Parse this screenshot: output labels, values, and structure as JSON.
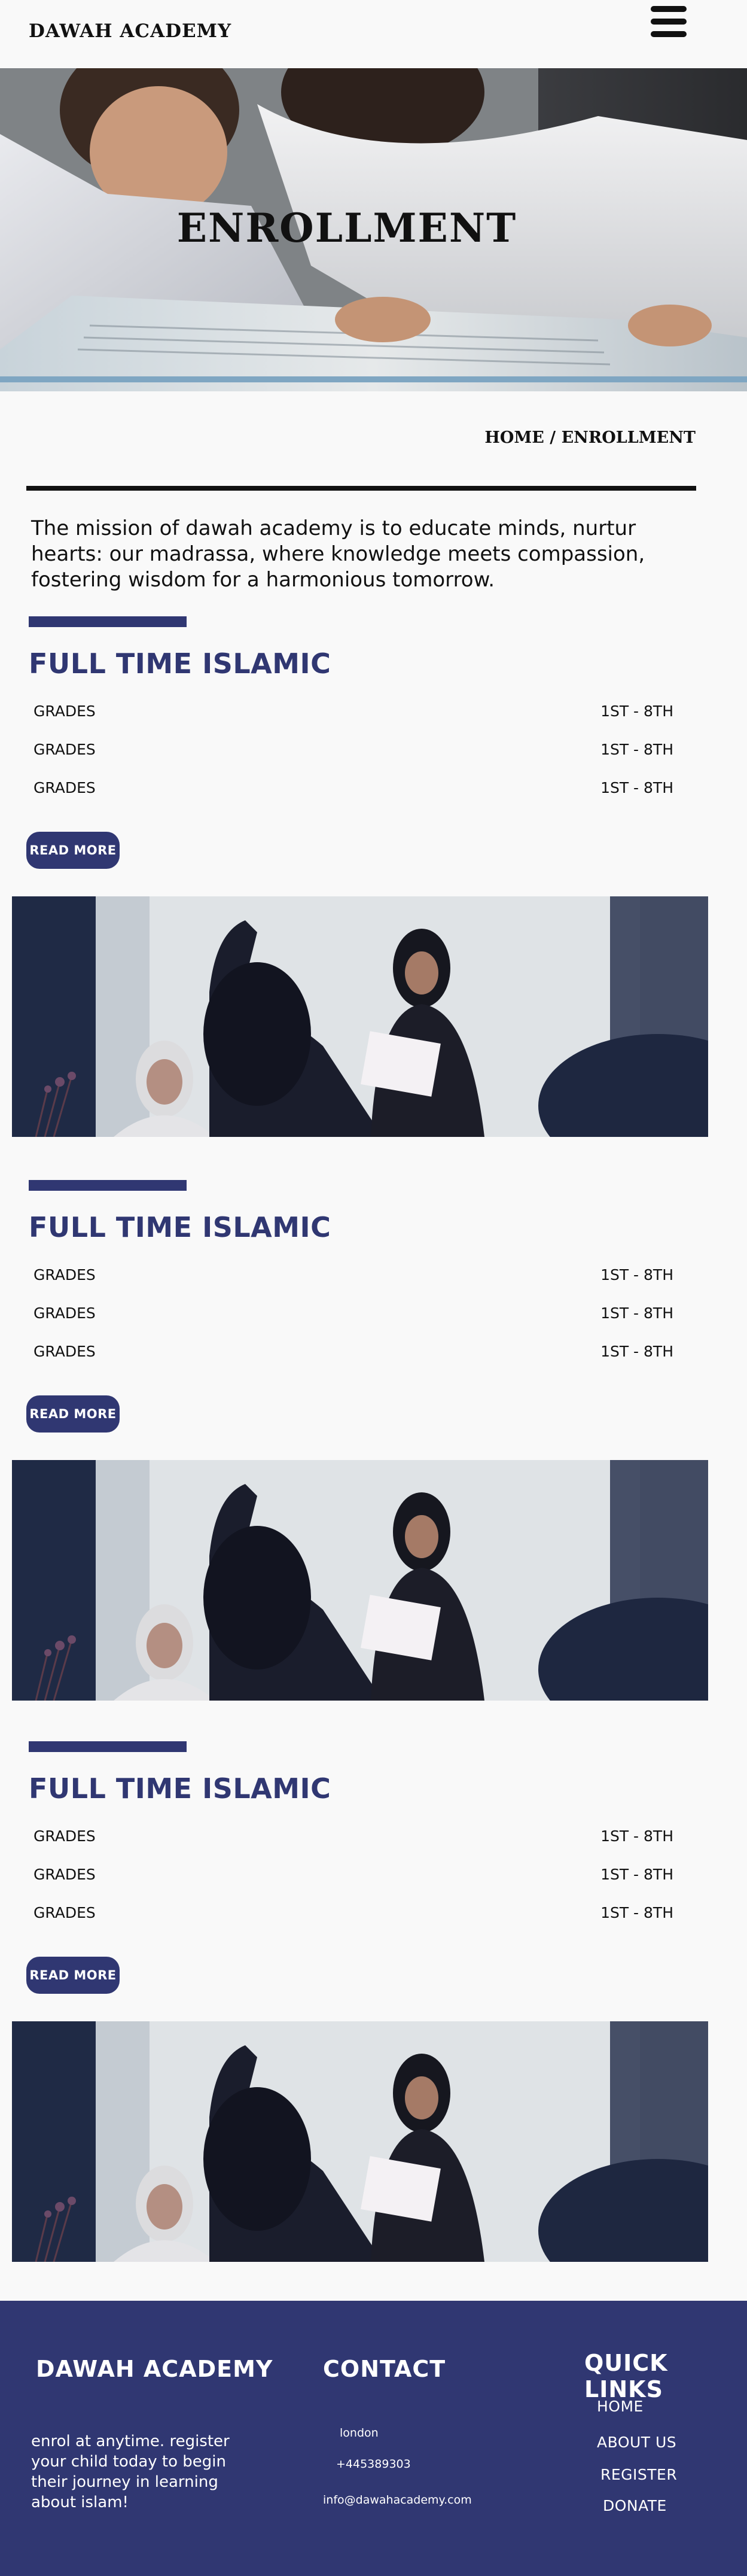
{
  "header": {
    "logo": "DAWAH ACADEMY",
    "menu_icon": "hamburger-menu-icon"
  },
  "hero": {
    "title": "ENROLLMENT"
  },
  "breadcrumb": {
    "home": "HOME",
    "separator": " / ",
    "current": "ENROLLMENT"
  },
  "mission": "The mission of dawah academy is to educate minds, nurtur hearts: our madrassa, where knowledge meets compassion, fostering wisdom for a harmonious tomorrow.",
  "programs": [
    {
      "title": "FULL TIME ISLAMIC",
      "rows": [
        {
          "label": "GRADES",
          "value": "1ST -  8TH"
        },
        {
          "label": "GRADES",
          "value": "1ST -  8TH"
        },
        {
          "label": "GRADES",
          "value": "1ST -  8TH"
        }
      ],
      "button": "READ MORE"
    },
    {
      "title": "FULL TIME ISLAMIC",
      "rows": [
        {
          "label": "GRADES",
          "value": "1ST -  8TH"
        },
        {
          "label": "GRADES",
          "value": "1ST -  8TH"
        },
        {
          "label": "GRADES",
          "value": "1ST -  8TH"
        }
      ],
      "button": "READ MORE"
    },
    {
      "title": "FULL TIME ISLAMIC",
      "rows": [
        {
          "label": "GRADES",
          "value": "1ST -  8TH"
        },
        {
          "label": "GRADES",
          "value": "1ST -  8TH"
        },
        {
          "label": "GRADES",
          "value": "1ST -  8TH"
        }
      ],
      "button": "READ MORE"
    }
  ],
  "footer": {
    "brand": "DAWAH ACADEMY",
    "tagline": "enrol at anytime. register your child today to begin their journey in learning about islam!",
    "contact_heading": "CONTACT",
    "location": "london",
    "phone": "+445389303",
    "email": "info@dawahacademy.com",
    "links_heading": "QUICK LINKS",
    "links": [
      "HOME",
      "ABOUT US",
      "REGISTER",
      "DONATE"
    ]
  },
  "colors": {
    "brand": "#303772",
    "background": "#f9f9f9",
    "text": "#111111"
  }
}
